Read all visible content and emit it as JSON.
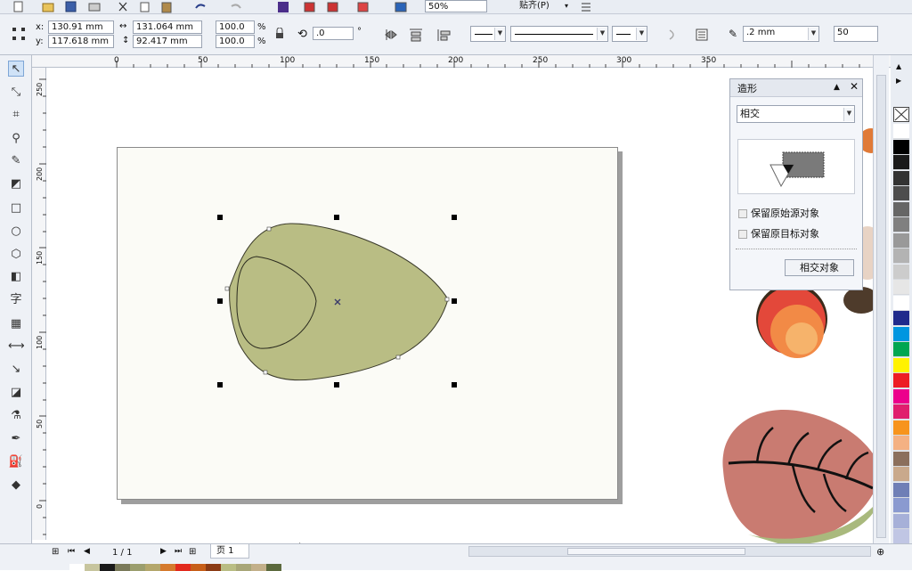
{
  "toolbar": {
    "zoom_value": "50%",
    "snap_label": "贴齐(P)"
  },
  "propertybar": {
    "x_label": "x:",
    "x_value": "130.91 mm",
    "y_label": "y:",
    "y_value": "117.618 mm",
    "width_value": "131.064 mm",
    "height_value": "92.417 mm",
    "scale_x": "100.0",
    "scale_y": "100.0",
    "percent": "%",
    "rotation_value": ".0",
    "degree": "°",
    "outline_width": ".2 mm",
    "text_size": "50"
  },
  "ruler": {
    "h_ticks": [
      "0",
      "50",
      "100",
      "150",
      "200",
      "250",
      "300",
      "350"
    ],
    "v_ticks": [
      "250",
      "200",
      "150",
      "100",
      "50",
      "0"
    ]
  },
  "docker": {
    "title": "造形",
    "mode": "相交",
    "option_source": "保留原始源对象",
    "option_target": "保留原目标对象",
    "apply_button": "相交对象"
  },
  "status": {
    "page_count": "1 / 1",
    "page_tab": "页 1"
  },
  "colors": {
    "shape_fill": "#b9bd84",
    "canvas_bg": "#ffffff",
    "page_bg": "#fbfbf6"
  },
  "palette": [
    "#ffffff",
    "#000000",
    "#1a1a1a",
    "#333333",
    "#4d4d4d",
    "#666666",
    "#808080",
    "#999999",
    "#b3b3b3",
    "#cccccc",
    "#e6e6e6",
    "#ffffff",
    "#1f2a8c",
    "#0096e0",
    "#00a651",
    "#fff200",
    "#ed1c24",
    "#ec008c",
    "#e01e6e",
    "#f7941d",
    "#f4b183",
    "#8b6f5c",
    "#c9a98c",
    "#6f7fb6",
    "#8a9ad0",
    "#a6b0d8",
    "#c0c6e4",
    "#4b5a9a"
  ],
  "bottom_swatches": [
    "#ffffff",
    "#c7c59e",
    "#1a1a1a",
    "#7a7a5a",
    "#9b9e6e",
    "#b4a76c",
    "#d57a2d",
    "#e22a1d",
    "#c75f19",
    "#8b3b15",
    "#b9bd84",
    "#a8a678",
    "#c3b08a",
    "#5c6a3e"
  ]
}
